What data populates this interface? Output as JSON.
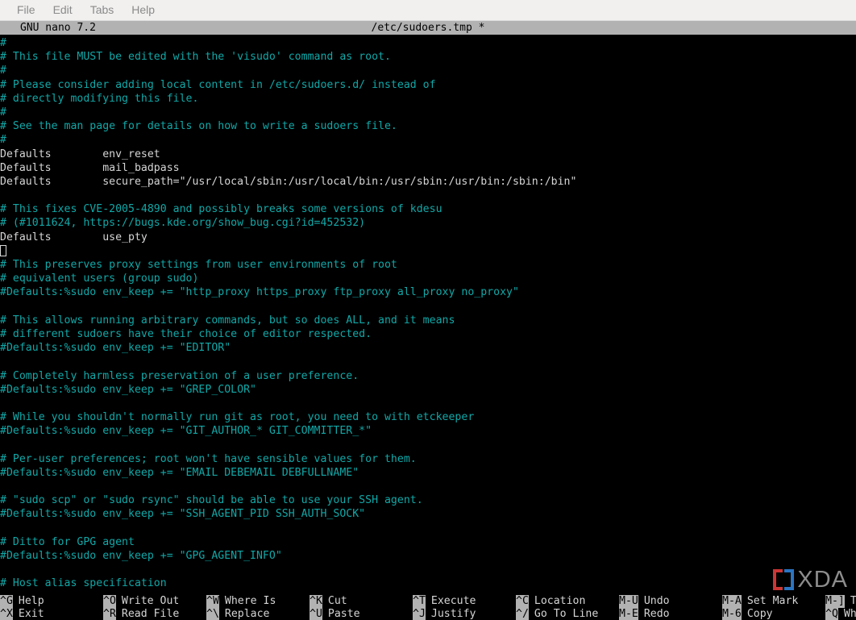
{
  "menubar": {
    "items": [
      {
        "label": "File",
        "name": "menu-file"
      },
      {
        "label": "Edit",
        "name": "menu-edit"
      },
      {
        "label": "Tabs",
        "name": "menu-tabs"
      },
      {
        "label": "Help",
        "name": "menu-help"
      }
    ]
  },
  "titlebar": {
    "version": "GNU nano 7.2",
    "filename": "/etc/sudoers.tmp *"
  },
  "editor": {
    "cursor_line_index": 15,
    "lines": [
      {
        "text": "#",
        "kind": "comment"
      },
      {
        "text": "# This file MUST be edited with the 'visudo' command as root.",
        "kind": "comment"
      },
      {
        "text": "#",
        "kind": "comment"
      },
      {
        "text": "# Please consider adding local content in /etc/sudoers.d/ instead of",
        "kind": "comment"
      },
      {
        "text": "# directly modifying this file.",
        "kind": "comment"
      },
      {
        "text": "#",
        "kind": "comment"
      },
      {
        "text": "# See the man page for details on how to write a sudoers file.",
        "kind": "comment"
      },
      {
        "text": "#",
        "kind": "comment"
      },
      {
        "text": "Defaults        env_reset",
        "kind": "code"
      },
      {
        "text": "Defaults        mail_badpass",
        "kind": "code"
      },
      {
        "text": "Defaults        secure_path=\"/usr/local/sbin:/usr/local/bin:/usr/sbin:/usr/bin:/sbin:/bin\"",
        "kind": "code"
      },
      {
        "text": "",
        "kind": "blank"
      },
      {
        "text": "# This fixes CVE-2005-4890 and possibly breaks some versions of kdesu",
        "kind": "comment"
      },
      {
        "text": "# (#1011624, https://bugs.kde.org/show_bug.cgi?id=452532)",
        "kind": "comment"
      },
      {
        "text": "Defaults        use_pty",
        "kind": "code"
      },
      {
        "text": "",
        "kind": "blank"
      },
      {
        "text": "# This preserves proxy settings from user environments of root",
        "kind": "comment"
      },
      {
        "text": "# equivalent users (group sudo)",
        "kind": "comment"
      },
      {
        "text": "#Defaults:%sudo env_keep += \"http_proxy https_proxy ftp_proxy all_proxy no_proxy\"",
        "kind": "comment"
      },
      {
        "text": "",
        "kind": "blank"
      },
      {
        "text": "# This allows running arbitrary commands, but so does ALL, and it means",
        "kind": "comment"
      },
      {
        "text": "# different sudoers have their choice of editor respected.",
        "kind": "comment"
      },
      {
        "text": "#Defaults:%sudo env_keep += \"EDITOR\"",
        "kind": "comment"
      },
      {
        "text": "",
        "kind": "blank"
      },
      {
        "text": "# Completely harmless preservation of a user preference.",
        "kind": "comment"
      },
      {
        "text": "#Defaults:%sudo env_keep += \"GREP_COLOR\"",
        "kind": "comment"
      },
      {
        "text": "",
        "kind": "blank"
      },
      {
        "text": "# While you shouldn't normally run git as root, you need to with etckeeper",
        "kind": "comment"
      },
      {
        "text": "#Defaults:%sudo env_keep += \"GIT_AUTHOR_* GIT_COMMITTER_*\"",
        "kind": "comment"
      },
      {
        "text": "",
        "kind": "blank"
      },
      {
        "text": "# Per-user preferences; root won't have sensible values for them.",
        "kind": "comment"
      },
      {
        "text": "#Defaults:%sudo env_keep += \"EMAIL DEBEMAIL DEBFULLNAME\"",
        "kind": "comment"
      },
      {
        "text": "",
        "kind": "blank"
      },
      {
        "text": "# \"sudo scp\" or \"sudo rsync\" should be able to use your SSH agent.",
        "kind": "comment"
      },
      {
        "text": "#Defaults:%sudo env_keep += \"SSH_AGENT_PID SSH_AUTH_SOCK\"",
        "kind": "comment"
      },
      {
        "text": "",
        "kind": "blank"
      },
      {
        "text": "# Ditto for GPG agent",
        "kind": "comment"
      },
      {
        "text": "#Defaults:%sudo env_keep += \"GPG_AGENT_INFO\"",
        "kind": "comment"
      },
      {
        "text": "",
        "kind": "blank"
      },
      {
        "text": "# Host alias specification",
        "kind": "comment"
      }
    ]
  },
  "watermark": {
    "text": "XDA"
  },
  "helpbar": {
    "row1": [
      {
        "key": "^G",
        "label": "Help",
        "name": "help-shortcut-help"
      },
      {
        "key": "^O",
        "label": "Write Out",
        "name": "help-shortcut-write-out"
      },
      {
        "key": "^W",
        "label": "Where Is",
        "name": "help-shortcut-where-is"
      },
      {
        "key": "^K",
        "label": "Cut",
        "name": "help-shortcut-cut"
      },
      {
        "key": "^T",
        "label": "Execute",
        "name": "help-shortcut-execute"
      },
      {
        "key": "^C",
        "label": "Location",
        "name": "help-shortcut-location"
      },
      {
        "key": "M-U",
        "label": "Undo",
        "name": "help-shortcut-undo"
      },
      {
        "key": "M-A",
        "label": "Set Mark",
        "name": "help-shortcut-set-mark"
      },
      {
        "key": "M-]",
        "label": "T",
        "name": "help-shortcut-to-bracket"
      }
    ],
    "row2": [
      {
        "key": "^X",
        "label": "Exit",
        "name": "help-shortcut-exit"
      },
      {
        "key": "^R",
        "label": "Read File",
        "name": "help-shortcut-read-file"
      },
      {
        "key": "^\\",
        "label": "Replace",
        "name": "help-shortcut-replace"
      },
      {
        "key": "^U",
        "label": "Paste",
        "name": "help-shortcut-paste"
      },
      {
        "key": "^J",
        "label": "Justify",
        "name": "help-shortcut-justify"
      },
      {
        "key": "^/",
        "label": "Go To Line",
        "name": "help-shortcut-go-to-line"
      },
      {
        "key": "M-E",
        "label": "Redo",
        "name": "help-shortcut-redo"
      },
      {
        "key": "M-6",
        "label": "Copy",
        "name": "help-shortcut-copy"
      },
      {
        "key": "^Q",
        "label": "Wh",
        "name": "help-shortcut-where-was"
      }
    ]
  },
  "colors": {
    "comment": "#11a8a8",
    "code": "#d5d5d5",
    "titlebar_bg": "#b2b2b2",
    "terminal_bg": "#000000",
    "menubar_bg": "#f1f0ef"
  }
}
